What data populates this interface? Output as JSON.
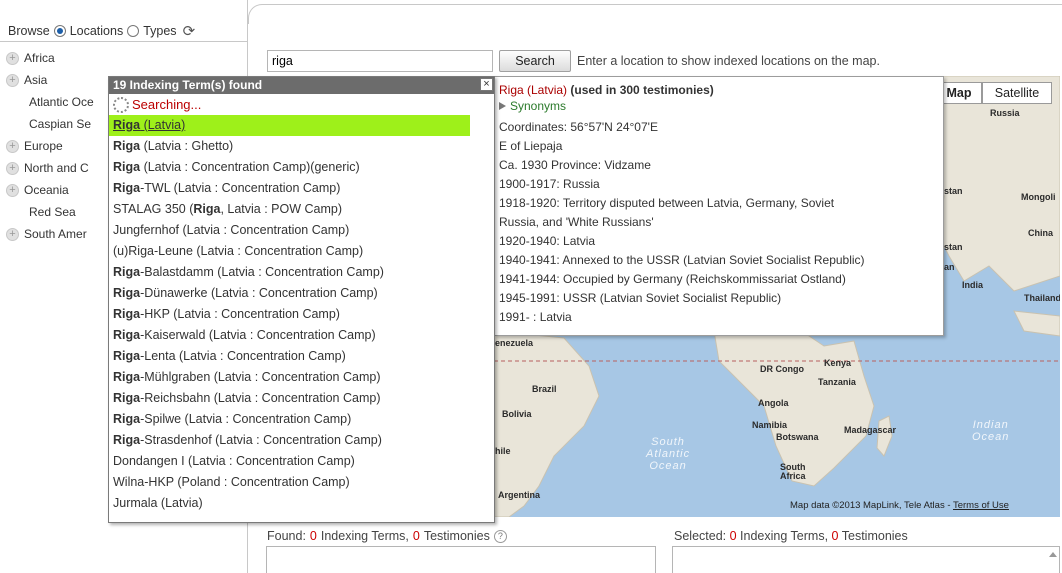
{
  "sidebar": {
    "browse_label": "Browse",
    "locations_label": "Locations",
    "types_label": "Types",
    "items": [
      {
        "label": "Africa",
        "expandable": true
      },
      {
        "label": "Asia",
        "expandable": true
      },
      {
        "label": "Atlantic Oce",
        "expandable": false
      },
      {
        "label": "Caspian Se",
        "expandable": false
      },
      {
        "label": "Europe",
        "expandable": true
      },
      {
        "label": "North and C",
        "expandable": true
      },
      {
        "label": "Oceania",
        "expandable": true
      },
      {
        "label": "Red Sea",
        "expandable": false
      },
      {
        "label": "South Amer",
        "expandable": true
      }
    ]
  },
  "search": {
    "value": "riga",
    "button_label": "Search",
    "hint": "Enter a location to show indexed locations on the map."
  },
  "autocomplete": {
    "header": "19 Indexing Term(s) found",
    "close": "×",
    "searching": "Searching...",
    "rows": [
      {
        "pre": "",
        "bold": "Riga",
        "rest": " (Latvia)",
        "highlighted": true
      },
      {
        "pre": "",
        "bold": "Riga",
        "rest": " (Latvia : Ghetto)",
        "highlighted": false
      },
      {
        "pre": "",
        "bold": "Riga",
        "rest": " (Latvia : Concentration Camp)(generic)",
        "highlighted": false
      },
      {
        "pre": "",
        "bold": "Riga",
        "rest": "-TWL (Latvia : Concentration Camp)",
        "highlighted": false
      },
      {
        "pre": "STALAG 350 (",
        "bold": "Riga",
        "rest": ", Latvia : POW Camp)",
        "highlighted": false
      },
      {
        "pre": "Jungfernhof (Latvia : Concentration Camp)",
        "bold": "",
        "rest": "",
        "highlighted": false
      },
      {
        "pre": "(u)Riga-Leune (Latvia : Concentration Camp)",
        "bold": "",
        "rest": "",
        "highlighted": false
      },
      {
        "pre": "",
        "bold": "Riga",
        "rest": "-Balastdamm (Latvia : Concentration Camp)",
        "highlighted": false
      },
      {
        "pre": "",
        "bold": "Riga",
        "rest": "-Dünawerke (Latvia : Concentration Camp)",
        "highlighted": false
      },
      {
        "pre": "",
        "bold": "Riga",
        "rest": "-HKP (Latvia : Concentration Camp)",
        "highlighted": false
      },
      {
        "pre": "",
        "bold": "Riga",
        "rest": "-Kaiserwald (Latvia : Concentration Camp)",
        "highlighted": false
      },
      {
        "pre": "",
        "bold": "Riga",
        "rest": "-Lenta (Latvia : Concentration Camp)",
        "highlighted": false
      },
      {
        "pre": "",
        "bold": "Riga",
        "rest": "-Mühlgraben (Latvia : Concentration Camp)",
        "highlighted": false
      },
      {
        "pre": "",
        "bold": "Riga",
        "rest": "-Reichsbahn (Latvia : Concentration Camp)",
        "highlighted": false
      },
      {
        "pre": "",
        "bold": "Riga",
        "rest": "-Spilwe (Latvia : Concentration Camp)",
        "highlighted": false
      },
      {
        "pre": "",
        "bold": "Riga",
        "rest": "-Strasdenhof (Latvia : Concentration Camp)",
        "highlighted": false
      },
      {
        "pre": "Dondangen I (Latvia : Concentration Camp)",
        "bold": "",
        "rest": "",
        "highlighted": false
      },
      {
        "pre": "Wilna-HKP (Poland : Concentration Camp)",
        "bold": "",
        "rest": "",
        "highlighted": false
      },
      {
        "pre": "Jurmala (Latvia)",
        "bold": "",
        "rest": "",
        "highlighted": false
      }
    ]
  },
  "details": {
    "title": "Riga (Latvia)",
    "title_suffix": "(used in 300 testimonies)",
    "synonyms": "Synonyms",
    "lines": [
      "Coordinates: 56°57'N 24°07'E",
      "E of Liepaja",
      "Ca. 1930 Province: Vidzame",
      "1900-1917: Russia",
      "1918-1920: Territory disputed between Latvia, Germany, Soviet",
      "Russia, and 'White Russians'",
      "1920-1940: Latvia",
      "1940-1941: Annexed to the USSR (Latvian Soviet Socialist Republic)",
      "1941-1944: Occupied by Germany (Reichskommissariat Ostland)",
      "1945-1991: USSR (Latvian Soviet Socialist Republic)",
      "1991- : Latvia"
    ]
  },
  "map": {
    "map_button": "Map",
    "satellite_button": "Satellite",
    "labels": {
      "russia": "Russia",
      "mongoli": "Mongoli",
      "china": "China",
      "india": "India",
      "thailand": "Thailand",
      "stan1": "stan",
      "stan2": "stan",
      "an": "an",
      "enezuela": "enezuela",
      "kenya": "Kenya",
      "dr_congo": "DR Congo",
      "tanzania": "Tanzania",
      "brazil": "Brazil",
      "angola": "Angola",
      "bolivia": "Bolivia",
      "namibia": "Namibia",
      "botswana": "Botswana",
      "madagascar": "Madagascar",
      "hile": "hile",
      "south_africa_1": "South",
      "south_africa_2": "Africa",
      "argentina": "Argentina"
    },
    "oceans": {
      "south_atlantic": [
        "South",
        "Atlantic",
        "Ocean"
      ],
      "indian": [
        "Indian",
        "Ocean"
      ]
    },
    "attribution": "Map data ©2013 MapLink, Tele Atlas - ",
    "terms": "Terms of Use",
    "colors": {
      "water": "#a7c7e5",
      "land": "#e9e5d9",
      "highlight": "#9ef01a"
    }
  },
  "bottom": {
    "found_label": "Found:",
    "found_terms": "0",
    "found_terms_text": "Indexing Terms,",
    "found_testimonies": "0",
    "found_testimonies_text": "Testimonies",
    "help": "?",
    "selected_label": "Selected:",
    "selected_terms": "0",
    "selected_terms_text": "Indexing Terms,",
    "selected_testimonies": "0",
    "selected_testimonies_text": "Testimonies"
  }
}
